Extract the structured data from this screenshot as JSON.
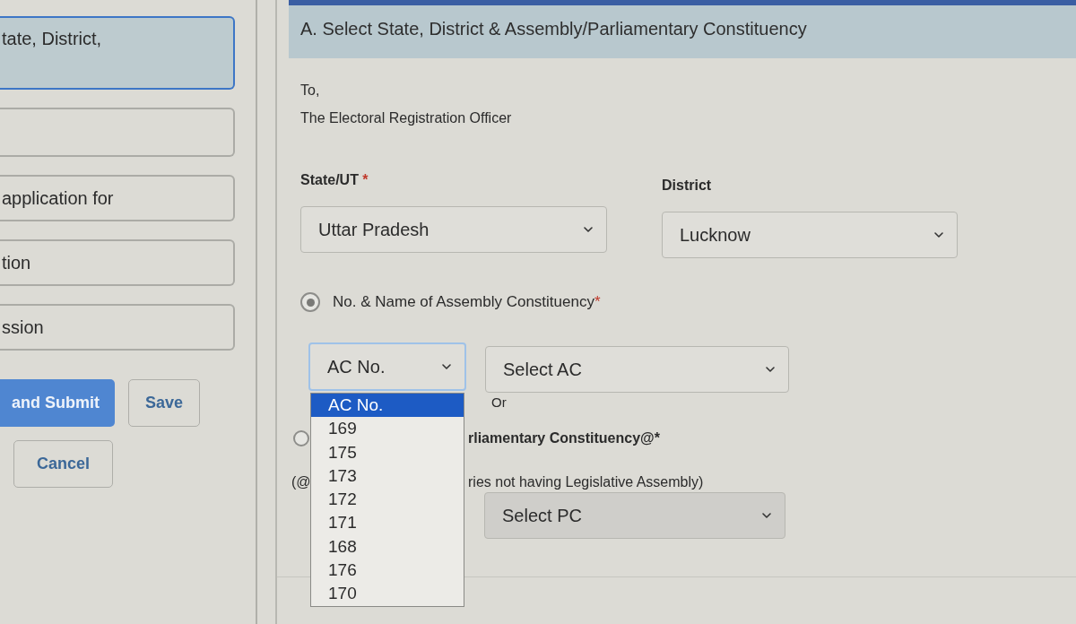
{
  "sidebar": {
    "steps": [
      {
        "label": "tate, District,",
        "selected": true
      },
      {
        "selected": false
      },
      {
        "label": "application for",
        "selected": false
      },
      {
        "label": "tion",
        "selected": false
      },
      {
        "label": "ssion",
        "selected": false
      }
    ],
    "buttons": [
      {
        "label": "and Submit",
        "kind": "primary"
      },
      {
        "label": "Save",
        "kind": "outline"
      },
      {
        "label": "Cancel",
        "kind": "outline"
      }
    ]
  },
  "section": {
    "title": "A. Select State, District & Assembly/Parliamentary Constituency",
    "address_lines": [
      "To,",
      "The Electoral Registration Officer"
    ],
    "fields": [
      {
        "label": "State/UT",
        "required_mark": "*",
        "value": "Uttar Pradesh"
      },
      {
        "label": "District",
        "value": "Lucknow"
      }
    ],
    "ac_option": {
      "label": "No. & Name of Assembly Constituency",
      "required_mark": "*",
      "selected": true
    },
    "ac_number": {
      "value": "AC No.",
      "focused": true,
      "expanded": true,
      "options": [
        {
          "label": "AC No.",
          "selected": true
        },
        {
          "label": "169",
          "selected": false
        },
        {
          "label": "175",
          "selected": false
        },
        {
          "label": "173",
          "selected": false
        },
        {
          "label": "172",
          "selected": false
        },
        {
          "label": "171",
          "selected": false
        },
        {
          "label": "168",
          "selected": false
        },
        {
          "label": "176",
          "selected": false
        },
        {
          "label": "170",
          "selected": false
        }
      ]
    },
    "ac_name": {
      "value": "Select AC"
    },
    "separator": "Or",
    "pc_option": {
      "label": "rliamentary Constituency@*",
      "selected": false
    },
    "pc_note": {
      "part_1": "(@",
      "part_2": "ries not having Legislative Assembly)"
    },
    "pc_select": {
      "value": "Select PC",
      "disabled": true
    }
  }
}
